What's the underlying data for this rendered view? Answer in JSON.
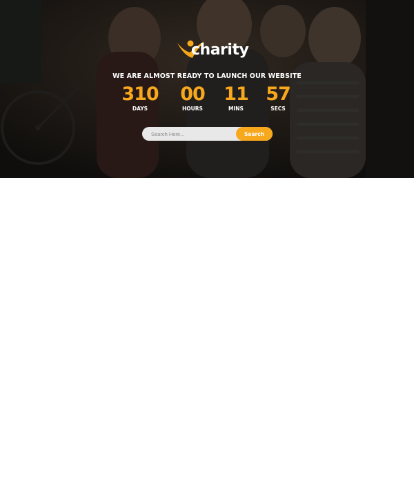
{
  "brand": {
    "name": "charity",
    "accent": "#f8a81c"
  },
  "hero": {
    "tagline": "WE ARE ALMOST READY TO LAUNCH OUR WEBSITE",
    "countdown": [
      {
        "value": "310",
        "label": "DAYS"
      },
      {
        "value": "00",
        "label": "HOURS"
      },
      {
        "value": "11",
        "label": "MINS"
      },
      {
        "value": "57",
        "label": "SECS"
      }
    ]
  },
  "search": {
    "placeholder": "Search Here...",
    "button_label": "Search"
  }
}
